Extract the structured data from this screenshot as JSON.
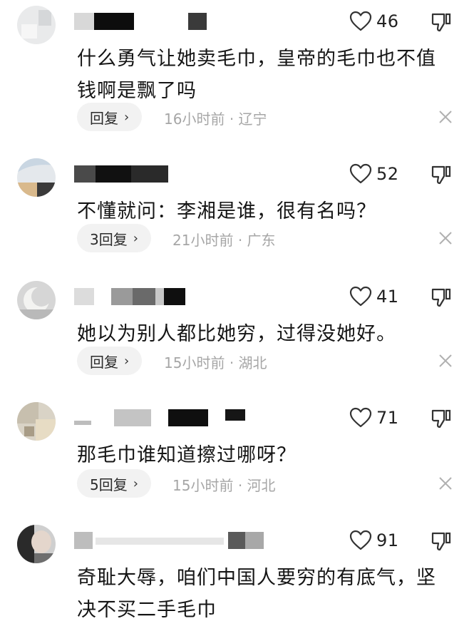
{
  "comments": [
    {
      "likes": "46",
      "content": "什么勇气让她卖毛巾，皇帝的毛巾也不值钱啊是飘了吗",
      "reply_label": "回复",
      "time": "16小时前",
      "location": "辽宁"
    },
    {
      "likes": "52",
      "content": "不懂就问：李湘是谁，很有名吗？",
      "reply_label": "3回复",
      "time": "21小时前",
      "location": "广东"
    },
    {
      "likes": "41",
      "content": "她以为别人都比她穷，过得没她好。",
      "reply_label": "回复",
      "time": "15小时前",
      "location": "湖北"
    },
    {
      "likes": "71",
      "content": "那毛巾谁知道擦过哪呀？",
      "reply_label": "5回复",
      "time": "15小时前",
      "location": "河北"
    },
    {
      "likes": "91",
      "content": "奇耻大辱，咱们中国人要穷的有底气，坚决不买二手毛巾",
      "reply_label": "",
      "time": "",
      "location": ""
    }
  ],
  "icons": {
    "like": "heart-outline-icon",
    "dislike": "thumbs-down-outline-icon",
    "dismiss": "close-icon",
    "reply_chevron": "chevron-right-icon"
  },
  "colors": {
    "text": "#151515",
    "meta": "#a6a6a6",
    "pill_bg": "#f2f2f2",
    "icon": "#333333"
  },
  "separator": "·",
  "chevron": "›"
}
